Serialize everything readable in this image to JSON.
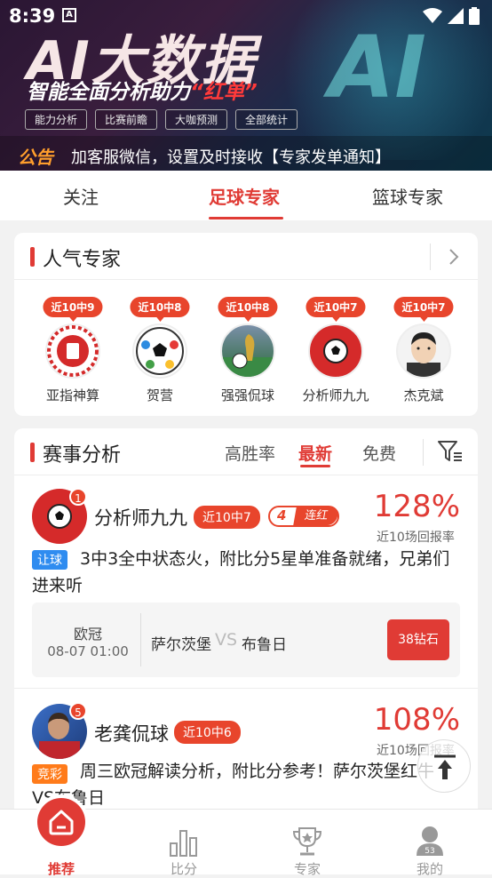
{
  "status_bar": {
    "time": "8:39",
    "a_icon": "A"
  },
  "banner": {
    "hero": "AI大数据",
    "sub_prefix": "智能全面分析助力",
    "sub_highlight": "“红单”",
    "ai_mark": "AI",
    "chips": [
      "能力分析",
      "比赛前瞻",
      "大咖预测",
      "全部统计"
    ],
    "notice_tag": "公告",
    "notice_text": "加客服微信，设置及时接收【专家发单通知】"
  },
  "tabs": [
    "关注",
    "足球专家",
    "篮球专家"
  ],
  "popular": {
    "title": "人气专家",
    "experts": [
      {
        "badge": "近10中9",
        "name": "亚指神算"
      },
      {
        "badge": "近10中8",
        "name": "贺营"
      },
      {
        "badge": "近10中8",
        "name": "强强侃球"
      },
      {
        "badge": "近10中7",
        "name": "分析师九九"
      },
      {
        "badge": "近10中7",
        "name": "杰克斌"
      }
    ]
  },
  "analysis": {
    "title": "赛事分析",
    "sub_tabs": [
      "高胜率",
      "最新",
      "免费"
    ],
    "posts": [
      {
        "rank": "1",
        "name": "分析师九九",
        "record": "近10中7",
        "streak_num": "4",
        "streak_label": "连红",
        "rate": "128%",
        "rate_label": "近10场回报率",
        "tag": "让球",
        "desc": "3中3全中状态火，附比分5星单准备就绪，兄弟们进来听",
        "league": "欧冠",
        "time": "08-07 01:00",
        "home": "萨尔茨堡",
        "vs": "VS",
        "away": "布鲁日",
        "price": "38钻石"
      },
      {
        "rank": "5",
        "name": "老龚侃球",
        "record": "近10中6",
        "rate": "108%",
        "rate_label": "近10场回报率",
        "tag": "竞彩",
        "desc": "周三欧冠解读分析，附比分参考！萨尔茨堡红牛VS布鲁日"
      }
    ]
  },
  "bottom_nav": [
    {
      "label": "推荐",
      "icon": "home-icon"
    },
    {
      "label": "比分",
      "icon": "chart-icon"
    },
    {
      "label": "专家",
      "icon": "trophy-icon"
    },
    {
      "label": "我的",
      "icon": "user-icon",
      "badge": "53"
    }
  ],
  "colors": {
    "accent": "#e03b35",
    "badge": "#e8452c",
    "tag_blue": "#2f8cf0",
    "tag_orange": "#ff7b1a"
  }
}
